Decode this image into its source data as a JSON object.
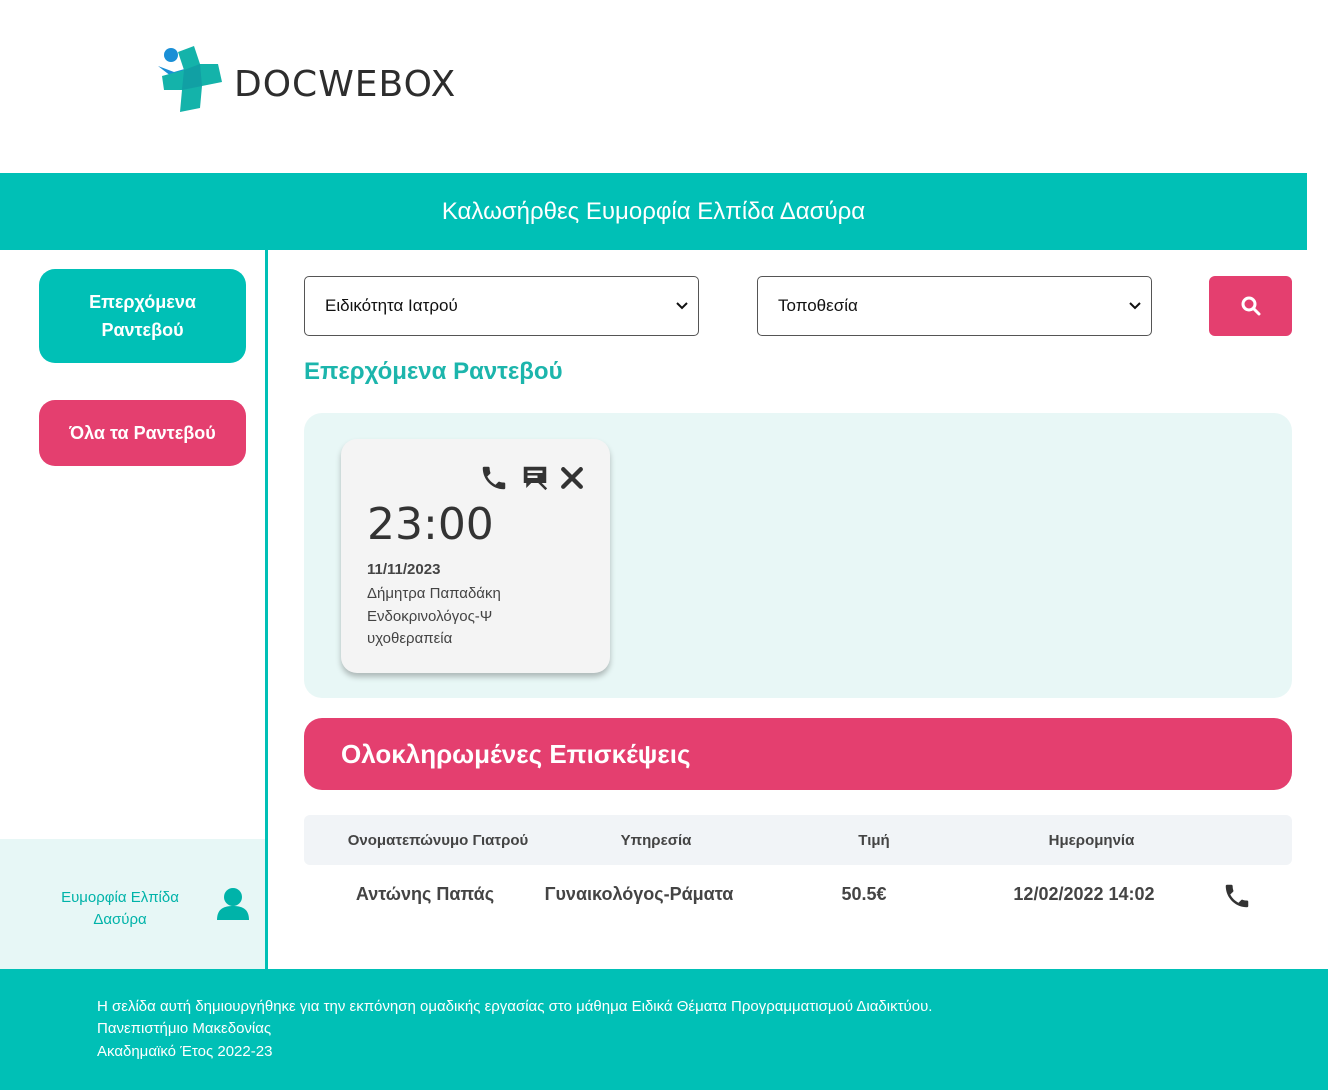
{
  "brand": {
    "name": "DOCWEBOX"
  },
  "welcome": "Καλωσήρθες Ευμορφία Ελπίδα Δασύρα",
  "sidebar": {
    "upcoming_label": "Επερχόμενα Ραντεβού",
    "all_label": "Όλα τα Ραντεβού",
    "user_name": "Ευμορφία Ελπίδα Δασύρα"
  },
  "filters": {
    "specialty": "Ειδικότητα Ιατρού",
    "location": "Τοποθεσία"
  },
  "upcoming": {
    "title": "Επερχόμενα Ραντεβού",
    "appointments": [
      {
        "time": "23:00",
        "date": "11/11/2023",
        "doctor": "Δήμητρα Παπαδάκη",
        "specialty": "Ενδοκρινολόγος-Ψυχοθεραπεία"
      }
    ]
  },
  "completed": {
    "title": "Ολοκληρωμένες Επισκέψεις",
    "columns": [
      "Ονοματεπώνυμο Γιατρού",
      "Υπηρεσία",
      "Τιμή",
      "Ημερομηνία"
    ],
    "rows": [
      {
        "doctor": "Αντώνης Παπάς",
        "service": "Γυναικολόγος-Ράματα",
        "price": "50.5€",
        "date": "12/02/2022 14:02"
      }
    ]
  },
  "footer": {
    "line1": "Η σελίδα αυτή δημιουργήθηκε για την εκπόνηση ομαδικής εργασίας στο μάθημα Ειδικά Θέματα Προγραμματισμού Διαδικτύου.",
    "line2": "Πανεπιστήμιο Μακεδονίας",
    "line3": "Ακαδημαϊκό Έτος 2022-23"
  },
  "colors": {
    "teal": "#00c0b6",
    "pink": "#e43f6f",
    "light_teal": "#e8f7f6"
  },
  "icons": [
    "docwebox-logo",
    "chevron-down-icon",
    "search-icon",
    "phone-icon",
    "chat-icon",
    "close-icon",
    "user-icon"
  ]
}
